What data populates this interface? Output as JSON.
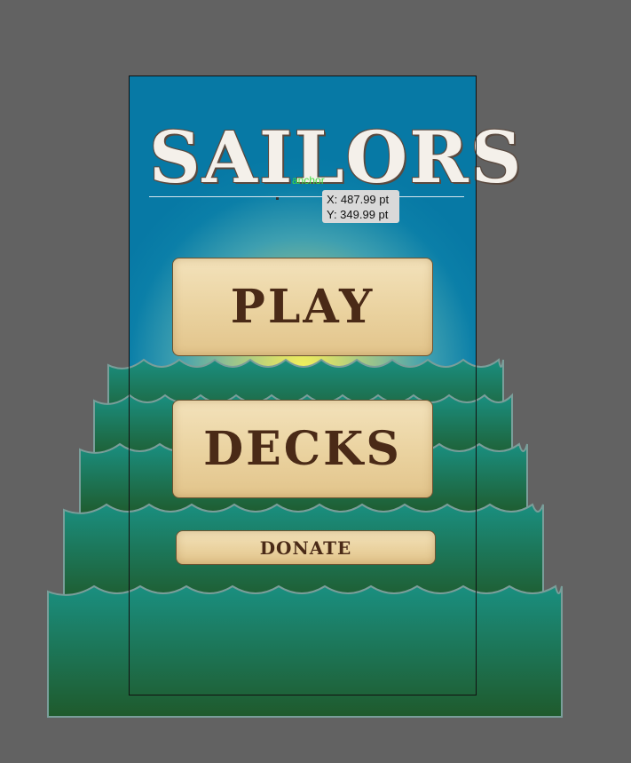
{
  "title": {
    "main": "SAILORS"
  },
  "anchor_label": "anchor",
  "coordinate_tooltip": {
    "x_text": "X: 487.99 pt",
    "y_text": "Y: 349.99 pt"
  },
  "menu": {
    "play_label": "PLAY",
    "decks_label": "DECKS",
    "donate_label": "DONATE"
  },
  "colors": {
    "canvas_bg": "#626262",
    "sky_top": "#0779a5",
    "sun_glow": "#f3f25a",
    "wave_top": "#1a8f80",
    "wave_bottom": "#1f5a2c",
    "button_face": "#ead29f",
    "button_text": "#4a2a17"
  }
}
